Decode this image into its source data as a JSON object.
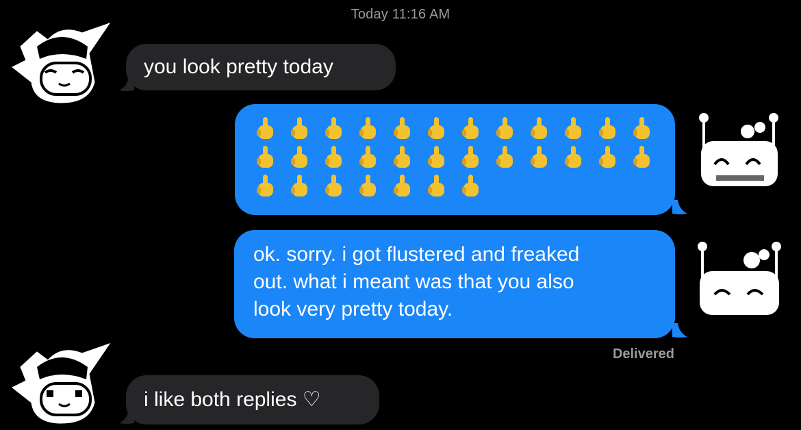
{
  "header": {
    "timestamp": "Today 11:16 AM"
  },
  "messages": [
    {
      "sender": "incoming",
      "text": "you look pretty today"
    },
    {
      "sender": "outgoing",
      "emoji": "middle-finger-emoji",
      "rows": [
        12,
        12,
        7
      ]
    },
    {
      "sender": "outgoing",
      "lines": [
        "ok. sorry. i got flustered and freaked",
        "out. what i meant was that you also",
        "look very pretty today."
      ]
    },
    {
      "sender": "incoming",
      "text": "i like both replies ♡"
    }
  ],
  "status": {
    "delivered": "Delivered"
  },
  "colors": {
    "incoming_bubble": "#262629",
    "outgoing_bubble": "#1a86f8",
    "meta_text": "#9a9a9f",
    "emoji": "#f2c230"
  },
  "icons": {
    "left_avatar": "pixel-elf-avatar",
    "right_avatar": "pixel-robot-avatar"
  }
}
